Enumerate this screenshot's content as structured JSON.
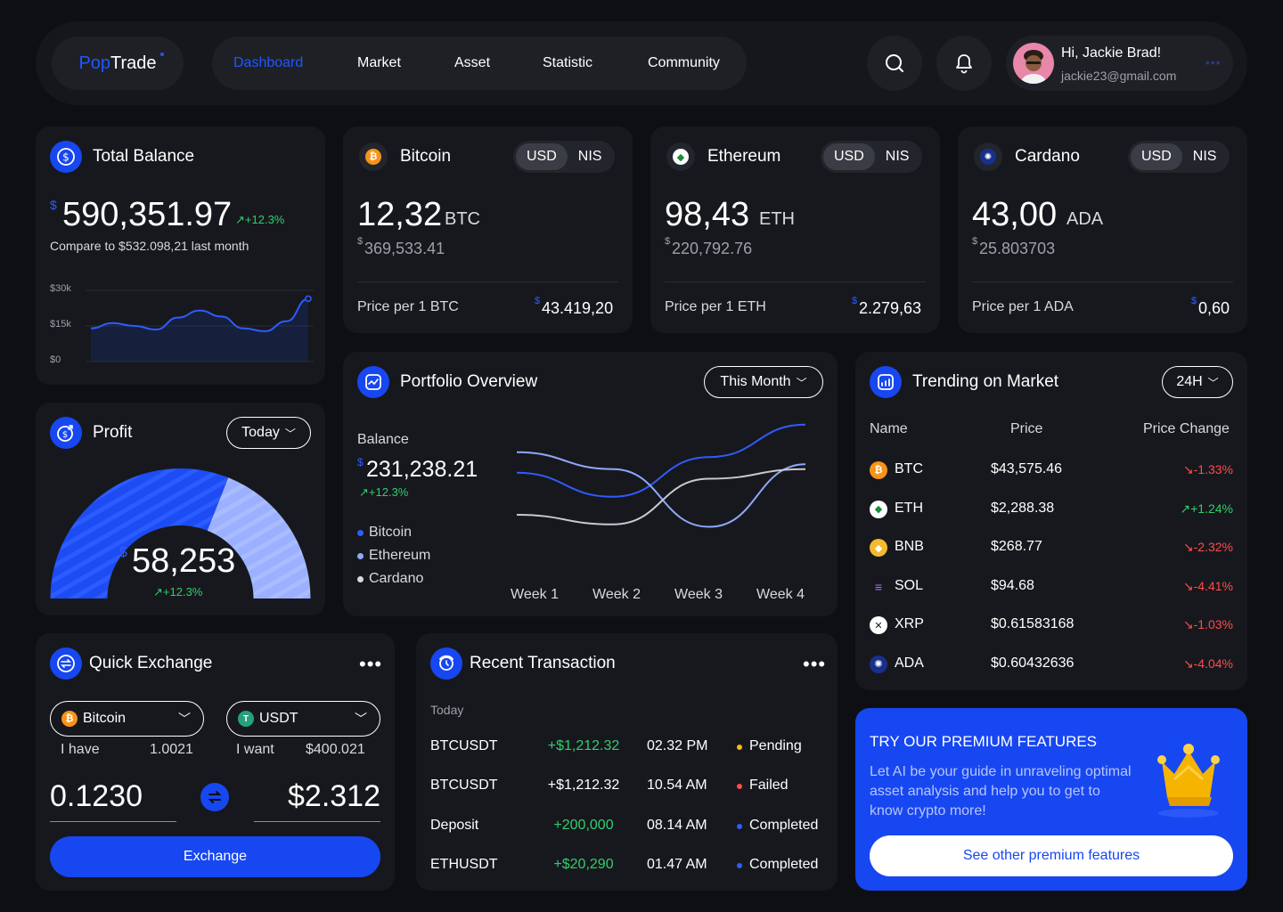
{
  "brand": {
    "pop": "Pop",
    "trade": "Trade"
  },
  "nav": {
    "items": [
      "Dashboard",
      "Market",
      "Asset",
      "Statistic",
      "Community"
    ]
  },
  "user": {
    "greeting": "Hi, Jackie Brad!",
    "email": "jackie23@gmail.com"
  },
  "total_balance": {
    "title": "Total Balance",
    "currency": "$",
    "amount": "590,351.97",
    "change": "+12.3%",
    "compare": "Compare to $532.098,21 last month",
    "chart_data": {
      "type": "line",
      "yticks": [
        "$30k",
        "$15k",
        "$0"
      ],
      "ylim": [
        0,
        30000
      ],
      "values": [
        14000,
        16200,
        15000,
        13500,
        18500,
        21500,
        19000,
        14000,
        12800,
        17000,
        26500
      ]
    }
  },
  "coins": [
    {
      "name": "Bitcoin",
      "usd": "USD",
      "nis": "NIS",
      "amount": "12,32",
      "unit": "BTC",
      "currency": "$",
      "value": "369,533.41",
      "price_label": "Price per 1 BTC",
      "price": "43.419,20"
    },
    {
      "name": "Ethereum",
      "usd": "USD",
      "nis": "NIS",
      "amount": "98,43",
      "unit": "ETH",
      "currency": "$",
      "value": "220,792.76",
      "price_label": "Price per 1 ETH",
      "price": "2.279,63"
    },
    {
      "name": "Cardano",
      "usd": "USD",
      "nis": "NIS",
      "amount": "43,00",
      "unit": "ADA",
      "currency": "$",
      "value": "25.803703",
      "price_label": "Price per 1 ADA",
      "price": "0,60"
    }
  ],
  "profit": {
    "title": "Profit",
    "period": "Today",
    "currency": "$",
    "amount": "58,253",
    "change": "+12.3%",
    "gauge_level": 0.62
  },
  "portfolio": {
    "title": "Portfolio Overview",
    "period": "This Month",
    "balance_label": "Balance",
    "currency": "$",
    "balance": "231,238.21",
    "change": "+12.3%",
    "legend": [
      "Bitcoin",
      "Ethereum",
      "Cardano"
    ],
    "chart_data": {
      "type": "line",
      "categories": [
        "Week 1",
        "Week 2",
        "Week 3",
        "Week 4"
      ],
      "series": [
        {
          "name": "Bitcoin",
          "color": "#2f5cff",
          "values": [
            0.55,
            0.35,
            0.68,
            0.95
          ]
        },
        {
          "name": "Ethereum",
          "color": "#8fa8ff",
          "values": [
            0.72,
            0.58,
            0.1,
            0.62
          ]
        },
        {
          "name": "Cardano",
          "color": "#c9c9d1",
          "values": [
            0.2,
            0.12,
            0.5,
            0.58
          ]
        }
      ]
    }
  },
  "trending": {
    "title": "Trending on Market",
    "period": "24H",
    "headers": [
      "Name",
      "Price",
      "Price Change"
    ],
    "rows": [
      {
        "name": "BTC",
        "price": "$43,575.46",
        "change": "-1.33%",
        "dir": "down",
        "color": "#f7931a",
        "glyph": "₿"
      },
      {
        "name": "ETH",
        "price": "$2,288.38",
        "change": "+1.24%",
        "dir": "up",
        "color": "#ffffff",
        "glyph": "◆"
      },
      {
        "name": "BNB",
        "price": "$268.77",
        "change": "-2.32%",
        "dir": "down",
        "color": "#f3ba2f",
        "glyph": "◆"
      },
      {
        "name": "SOL",
        "price": "$94.68",
        "change": "-4.41%",
        "dir": "down",
        "color": "#17181d",
        "glyph": "≡"
      },
      {
        "name": "XRP",
        "price": "$0.61583168",
        "change": "-1.03%",
        "dir": "down",
        "color": "#ffffff",
        "glyph": "✕"
      },
      {
        "name": "ADA",
        "price": "$0.60432636",
        "change": "-4.04%",
        "dir": "down",
        "color": "#1a2f8c",
        "glyph": "✺"
      }
    ]
  },
  "exchange": {
    "title": "Quick Exchange",
    "from_coin": "Bitcoin",
    "to_coin": "USDT",
    "have_label": "I have",
    "have_value": "1.0021",
    "want_label": "I want",
    "want_value": "$400.021",
    "from_amount": "0.1230",
    "to_amount": "$2.312",
    "button": "Exchange"
  },
  "transactions": {
    "title": "Recent Transaction",
    "day": "Today",
    "rows": [
      {
        "pair": "BTCUSDT",
        "amount": "+$1,212.32",
        "positive": true,
        "time": "02.32 PM",
        "status": "Pending",
        "status_color": "#f5b915"
      },
      {
        "pair": "BTCUSDT",
        "amount": "+$1,212.32",
        "positive": false,
        "time": "10.54 AM",
        "status": "Failed",
        "status_color": "#ff4b4b"
      },
      {
        "pair": "Deposit",
        "amount": "+200,000",
        "positive": true,
        "time": "08.14 AM",
        "status": "Completed",
        "status_color": "#2f5cff"
      },
      {
        "pair": "ETHUSDT",
        "amount": "+$20,290",
        "positive": true,
        "time": "01.47 AM",
        "status": "Completed",
        "status_color": "#2f5cff"
      }
    ]
  },
  "premium": {
    "title": "TRY OUR PREMIUM FEATURES",
    "body": "Let AI be your guide in unraveling optimal asset analysis and help you to get to know crypto more!",
    "button": "See other premium features"
  },
  "colors": {
    "accent": "#1747f0",
    "positive": "#2fcf6c",
    "negative": "#ff4b4b"
  }
}
